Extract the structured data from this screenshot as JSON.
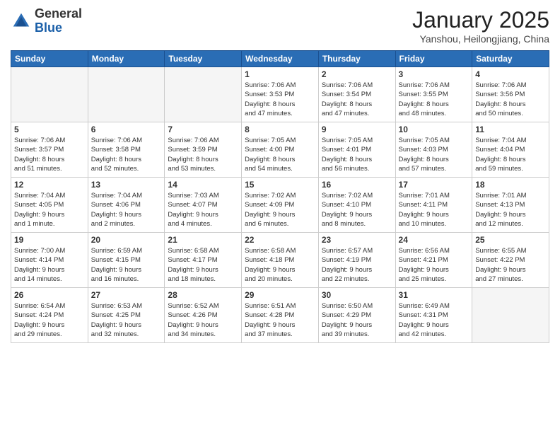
{
  "header": {
    "logo_general": "General",
    "logo_blue": "Blue",
    "title": "January 2025",
    "subtitle": "Yanshou, Heilongjiang, China"
  },
  "days_of_week": [
    "Sunday",
    "Monday",
    "Tuesday",
    "Wednesday",
    "Thursday",
    "Friday",
    "Saturday"
  ],
  "weeks": [
    [
      {
        "num": "",
        "info": ""
      },
      {
        "num": "",
        "info": ""
      },
      {
        "num": "",
        "info": ""
      },
      {
        "num": "1",
        "info": "Sunrise: 7:06 AM\nSunset: 3:53 PM\nDaylight: 8 hours\nand 47 minutes."
      },
      {
        "num": "2",
        "info": "Sunrise: 7:06 AM\nSunset: 3:54 PM\nDaylight: 8 hours\nand 47 minutes."
      },
      {
        "num": "3",
        "info": "Sunrise: 7:06 AM\nSunset: 3:55 PM\nDaylight: 8 hours\nand 48 minutes."
      },
      {
        "num": "4",
        "info": "Sunrise: 7:06 AM\nSunset: 3:56 PM\nDaylight: 8 hours\nand 50 minutes."
      }
    ],
    [
      {
        "num": "5",
        "info": "Sunrise: 7:06 AM\nSunset: 3:57 PM\nDaylight: 8 hours\nand 51 minutes."
      },
      {
        "num": "6",
        "info": "Sunrise: 7:06 AM\nSunset: 3:58 PM\nDaylight: 8 hours\nand 52 minutes."
      },
      {
        "num": "7",
        "info": "Sunrise: 7:06 AM\nSunset: 3:59 PM\nDaylight: 8 hours\nand 53 minutes."
      },
      {
        "num": "8",
        "info": "Sunrise: 7:05 AM\nSunset: 4:00 PM\nDaylight: 8 hours\nand 54 minutes."
      },
      {
        "num": "9",
        "info": "Sunrise: 7:05 AM\nSunset: 4:01 PM\nDaylight: 8 hours\nand 56 minutes."
      },
      {
        "num": "10",
        "info": "Sunrise: 7:05 AM\nSunset: 4:03 PM\nDaylight: 8 hours\nand 57 minutes."
      },
      {
        "num": "11",
        "info": "Sunrise: 7:04 AM\nSunset: 4:04 PM\nDaylight: 8 hours\nand 59 minutes."
      }
    ],
    [
      {
        "num": "12",
        "info": "Sunrise: 7:04 AM\nSunset: 4:05 PM\nDaylight: 9 hours\nand 1 minute."
      },
      {
        "num": "13",
        "info": "Sunrise: 7:04 AM\nSunset: 4:06 PM\nDaylight: 9 hours\nand 2 minutes."
      },
      {
        "num": "14",
        "info": "Sunrise: 7:03 AM\nSunset: 4:07 PM\nDaylight: 9 hours\nand 4 minutes."
      },
      {
        "num": "15",
        "info": "Sunrise: 7:02 AM\nSunset: 4:09 PM\nDaylight: 9 hours\nand 6 minutes."
      },
      {
        "num": "16",
        "info": "Sunrise: 7:02 AM\nSunset: 4:10 PM\nDaylight: 9 hours\nand 8 minutes."
      },
      {
        "num": "17",
        "info": "Sunrise: 7:01 AM\nSunset: 4:11 PM\nDaylight: 9 hours\nand 10 minutes."
      },
      {
        "num": "18",
        "info": "Sunrise: 7:01 AM\nSunset: 4:13 PM\nDaylight: 9 hours\nand 12 minutes."
      }
    ],
    [
      {
        "num": "19",
        "info": "Sunrise: 7:00 AM\nSunset: 4:14 PM\nDaylight: 9 hours\nand 14 minutes."
      },
      {
        "num": "20",
        "info": "Sunrise: 6:59 AM\nSunset: 4:15 PM\nDaylight: 9 hours\nand 16 minutes."
      },
      {
        "num": "21",
        "info": "Sunrise: 6:58 AM\nSunset: 4:17 PM\nDaylight: 9 hours\nand 18 minutes."
      },
      {
        "num": "22",
        "info": "Sunrise: 6:58 AM\nSunset: 4:18 PM\nDaylight: 9 hours\nand 20 minutes."
      },
      {
        "num": "23",
        "info": "Sunrise: 6:57 AM\nSunset: 4:19 PM\nDaylight: 9 hours\nand 22 minutes."
      },
      {
        "num": "24",
        "info": "Sunrise: 6:56 AM\nSunset: 4:21 PM\nDaylight: 9 hours\nand 25 minutes."
      },
      {
        "num": "25",
        "info": "Sunrise: 6:55 AM\nSunset: 4:22 PM\nDaylight: 9 hours\nand 27 minutes."
      }
    ],
    [
      {
        "num": "26",
        "info": "Sunrise: 6:54 AM\nSunset: 4:24 PM\nDaylight: 9 hours\nand 29 minutes."
      },
      {
        "num": "27",
        "info": "Sunrise: 6:53 AM\nSunset: 4:25 PM\nDaylight: 9 hours\nand 32 minutes."
      },
      {
        "num": "28",
        "info": "Sunrise: 6:52 AM\nSunset: 4:26 PM\nDaylight: 9 hours\nand 34 minutes."
      },
      {
        "num": "29",
        "info": "Sunrise: 6:51 AM\nSunset: 4:28 PM\nDaylight: 9 hours\nand 37 minutes."
      },
      {
        "num": "30",
        "info": "Sunrise: 6:50 AM\nSunset: 4:29 PM\nDaylight: 9 hours\nand 39 minutes."
      },
      {
        "num": "31",
        "info": "Sunrise: 6:49 AM\nSunset: 4:31 PM\nDaylight: 9 hours\nand 42 minutes."
      },
      {
        "num": "",
        "info": ""
      }
    ]
  ]
}
